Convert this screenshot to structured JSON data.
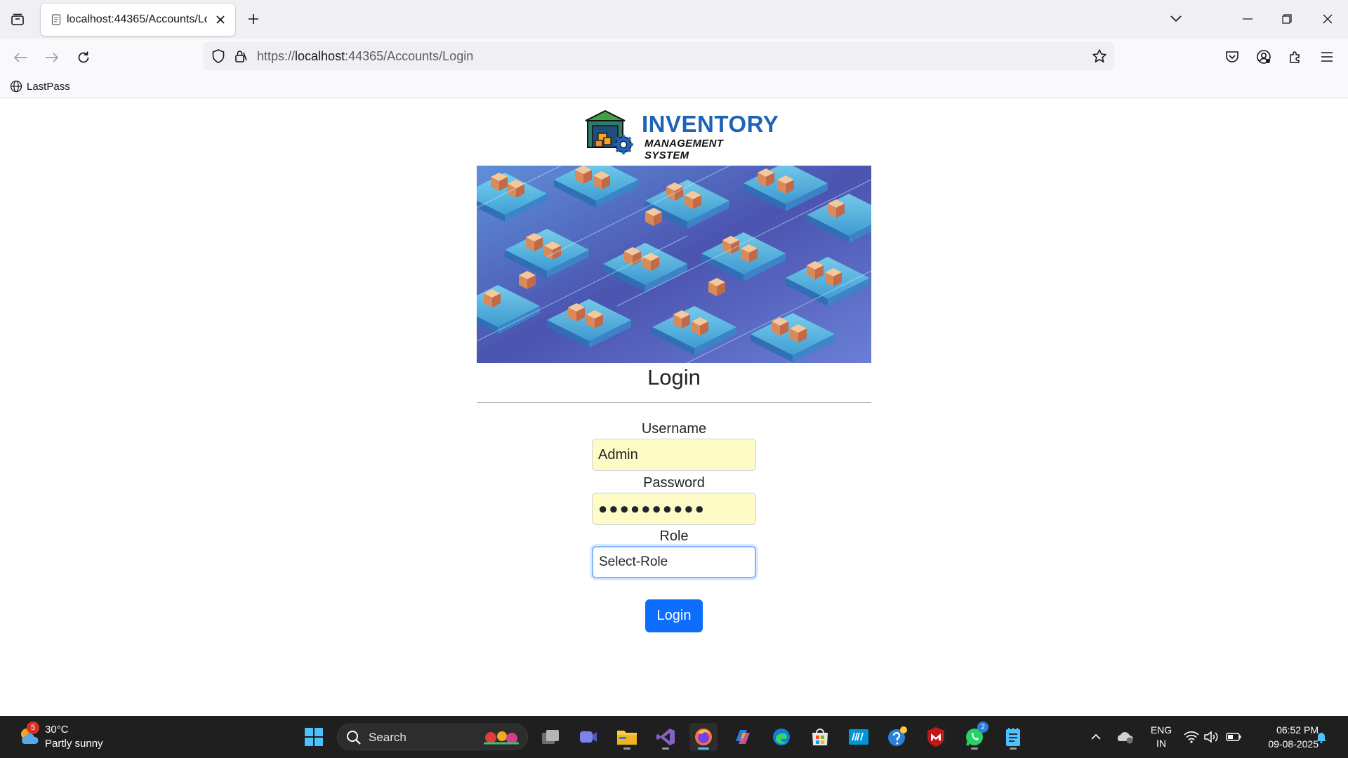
{
  "browser": {
    "tab_title": "localhost:44365/Accounts/Login",
    "url_scheme": "https://",
    "url_host": "localhost",
    "url_rest": ":44365/Accounts/Login",
    "bookmark_label": "LastPass"
  },
  "logo": {
    "title": "INVENTORY",
    "subtitle": "MANAGEMENT SYSTEM"
  },
  "login": {
    "heading": "Login",
    "username_label": "Username",
    "username_value": "Admin",
    "password_label": "Password",
    "password_masked": "●●●●●●●●●●",
    "role_label": "Role",
    "role_selected": "Select-Role",
    "button_label": "Login",
    "accent_color": "#0d6efd"
  },
  "taskbar": {
    "weather_badge": "5",
    "temperature": "30°C",
    "condition": "Partly sunny",
    "search_placeholder": "Search",
    "visual_studio_badge": "",
    "whatsapp_badge": "2",
    "lang_line1": "ENG",
    "lang_line2": "IN",
    "time": "06:52 PM",
    "date": "09-08-2025"
  }
}
